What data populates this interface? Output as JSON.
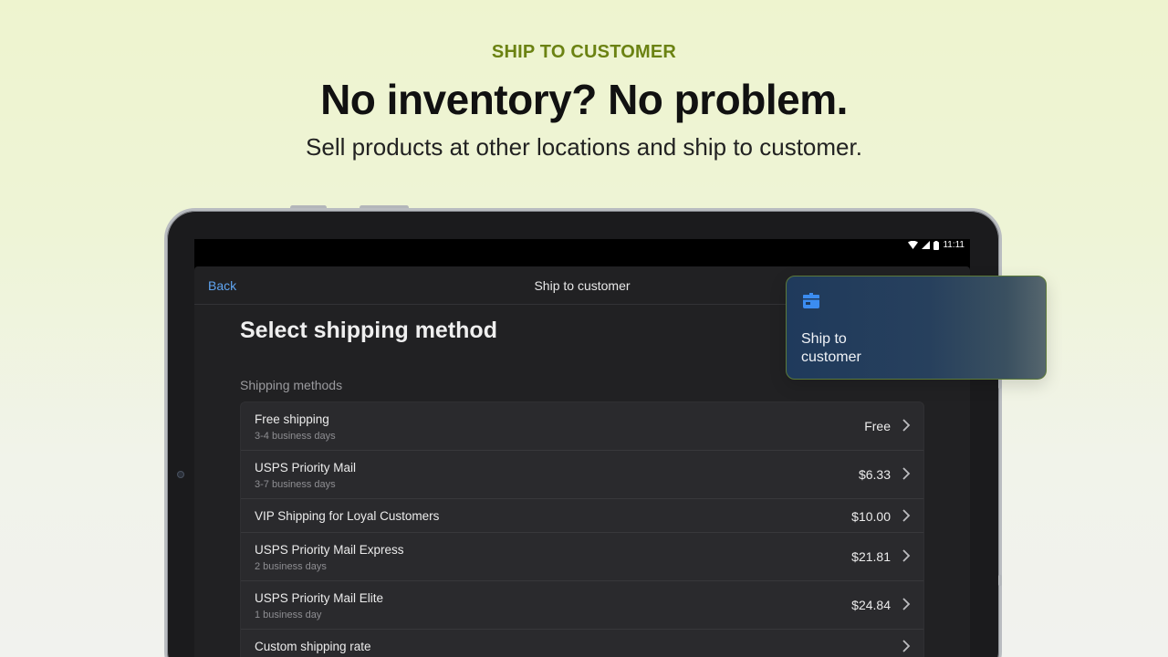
{
  "hero": {
    "eyebrow": "SHIP TO CUSTOMER",
    "headline": "No inventory? No problem.",
    "subline": "Sell products at other locations and ship to customer."
  },
  "statusbar": {
    "time": "11:11",
    "icons": [
      "wifi-icon",
      "signal-icon",
      "battery-icon"
    ]
  },
  "app": {
    "nav": {
      "back_label": "Back",
      "title": "Ship to customer"
    },
    "page_title": "Select shipping method",
    "section_label": "Shipping methods",
    "methods": [
      {
        "name": "Free shipping",
        "subtitle": "3-4 business days",
        "price": "Free"
      },
      {
        "name": "USPS Priority Mail",
        "subtitle": "3-7 business days",
        "price": "$6.33"
      },
      {
        "name": "VIP Shipping for Loyal Customers",
        "subtitle": "",
        "price": "$10.00"
      },
      {
        "name": "USPS Priority Mail Express",
        "subtitle": "2 business days",
        "price": "$21.81"
      },
      {
        "name": "USPS Priority Mail Elite",
        "subtitle": "1 business day",
        "price": "$24.84"
      },
      {
        "name": "Custom shipping rate",
        "subtitle": "",
        "price": ""
      }
    ]
  },
  "card": {
    "label": "Ship to customer",
    "icon": "package-icon"
  },
  "colors": {
    "eyebrow": "#6b8212",
    "link": "#5fa4f0",
    "card_icon": "#3b8cf0"
  }
}
